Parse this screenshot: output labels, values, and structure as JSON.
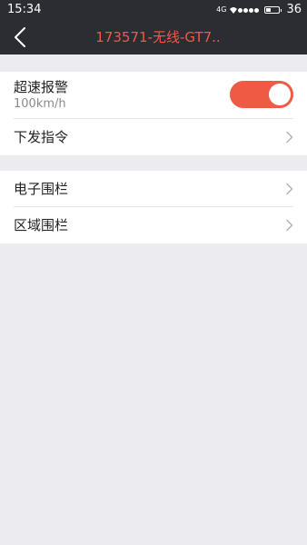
{
  "status_bar": {
    "time": "15:34",
    "network": "4G",
    "battery_text": "36",
    "battery_level": 0.36
  },
  "nav": {
    "title": "173571-无线-GT7.."
  },
  "group1": {
    "speed_alarm": {
      "title": "超速报警",
      "subtitle": "100km/h",
      "toggle_on": true
    },
    "send_command": {
      "label": "下发指令"
    }
  },
  "group2": {
    "electronic_fence": {
      "label": "电子围栏"
    },
    "area_fence": {
      "label": "区域围栏"
    }
  },
  "colors": {
    "accent": "#ef5a45",
    "bar_bg": "#2b2d33",
    "page_bg": "#ebebf0"
  }
}
